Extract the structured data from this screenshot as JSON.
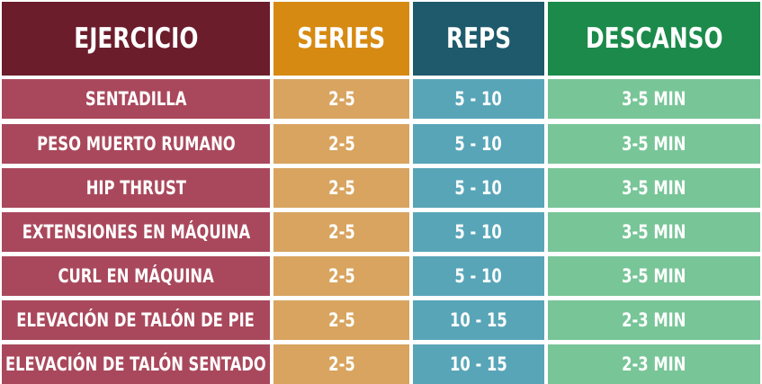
{
  "colors": {
    "ejercicio_header": "#6b1d2c",
    "series_header": "#d68a12",
    "reps_header": "#1f5a6c",
    "descanso_header": "#1b8a4a",
    "ejercicio_cells": "#a9485c",
    "series_cells": "#d8a45f",
    "reps_cells": "#58a5b8",
    "descanso_cells": "#78c598"
  },
  "headers": [
    "EJERCICIO",
    "SERIES",
    "REPS",
    "DESCANSO"
  ],
  "rows": [
    [
      "SENTADILLA",
      "2-5",
      "5 - 10",
      "3-5 MIN"
    ],
    [
      "PESO MUERTO RUMANO",
      "2-5",
      "5 - 10",
      "3-5 MIN"
    ],
    [
      "HIP THRUST",
      "2-5",
      "5 - 10",
      "3-5 MIN"
    ],
    [
      "EXTENSIONES EN MÁQUINA",
      "2-5",
      "5 - 10",
      "3-5 MIN"
    ],
    [
      "CURL EN MÁQUINA",
      "2-5",
      "5 - 10",
      "3-5 MIN"
    ],
    [
      "ELEVACIÓN DE TALÓN DE PIE",
      "2-5",
      "10 - 15",
      "2-3 MIN"
    ],
    [
      "ELEVACIÓN DE TALÓN SENTADO",
      "2-5",
      "10 - 15",
      "2-3 MIN"
    ]
  ]
}
